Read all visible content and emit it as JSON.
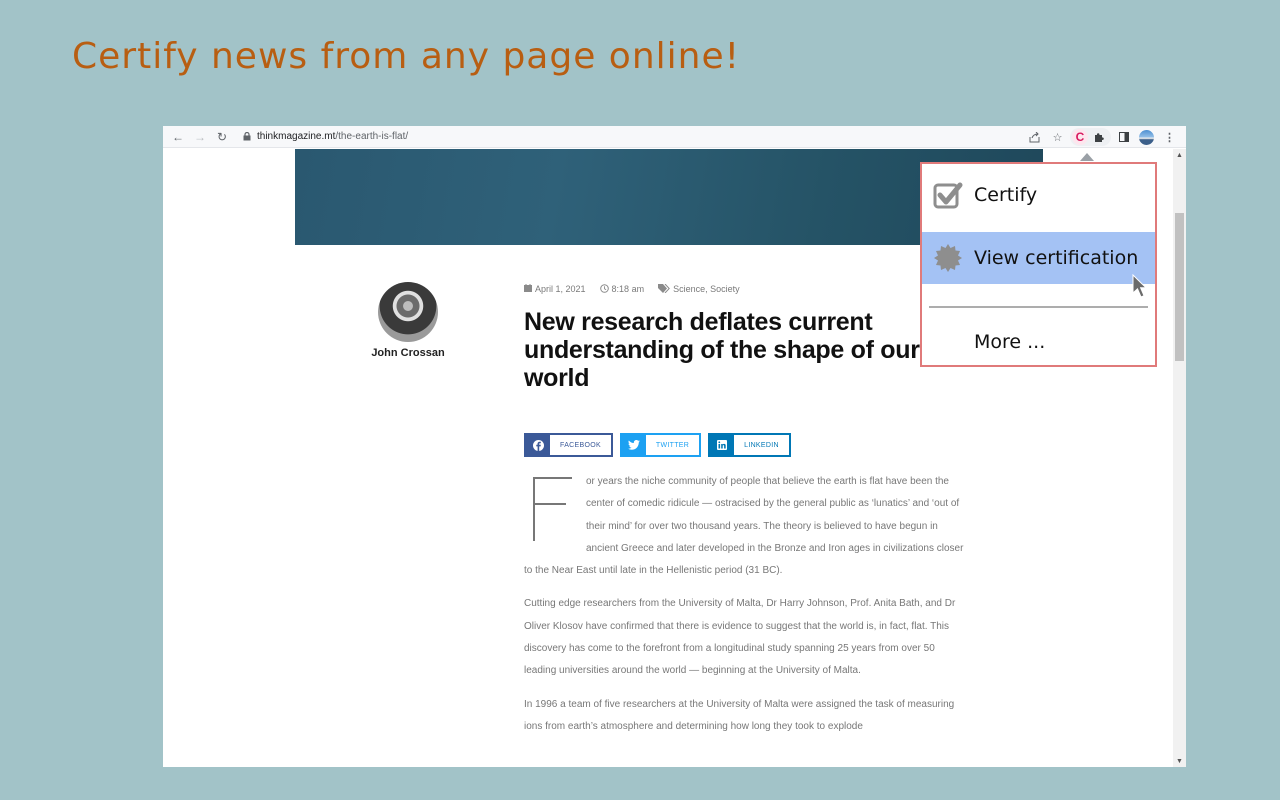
{
  "promo": {
    "title": "Certify news from any page online!"
  },
  "browser": {
    "url_host": "thinkmagazine.mt",
    "url_path": "/the-earth-is-flat/",
    "icons": {
      "back": "back-arrow-icon",
      "forward": "forward-arrow-icon",
      "reload": "reload-icon",
      "lock": "lock-icon",
      "share": "share-icon",
      "bookmark": "star-icon",
      "extension": "certify-extension-icon",
      "extensions_menu": "puzzle-icon",
      "side_panel": "side-panel-icon",
      "profile": "profile-avatar",
      "menu": "kebab-menu-icon"
    },
    "extension_letter": "C"
  },
  "article": {
    "author": "John Crossan",
    "date": "April 1, 2021",
    "time": "8:18 am",
    "categories": "Science, Society",
    "headline": "New research deflates current understanding of the shape of our world",
    "share_buttons": [
      {
        "label": "FACEBOOK",
        "icon": "f"
      },
      {
        "label": "TWITTER",
        "icon": "🐦"
      },
      {
        "label": "LINKEDIN",
        "icon": "in"
      }
    ],
    "dropcap": "F",
    "paragraphs": [
      "or years the niche community of people that believe the earth is flat have been the center of comedic ridicule — ostracised by the general public as ‘lunatics’ and ‘out of their mind’ for over two thousand years. The theory is believed to have begun in ancient Greece and later developed in the Bronze and Iron ages in civilizations closer to the Near East until late in the Hellenistic period (31 BC).",
      "Cutting edge researchers from the University of Malta, Dr Harry Johnson, Prof. Anita Bath, and Dr Oliver Klosov have confirmed that there is evidence to suggest that the world is, in fact, flat. This discovery has come to the forefront from a longitudinal study spanning 25 years from over 50 leading universities around the world — beginning at the University of Malta.",
      "In 1996 a team of five researchers at the University of Malta were assigned the task of measuring ions from earth’s atmosphere and determining how long they took to explode"
    ]
  },
  "popup": {
    "items": [
      {
        "label": "Certify",
        "icon": "checkbox-checked-icon"
      },
      {
        "label": "View certification",
        "icon": "seal-badge-icon",
        "highlighted": true
      },
      {
        "label": "More ..."
      }
    ],
    "colors": {
      "border": "#e07a7a",
      "highlight": "#a4c2f4"
    }
  },
  "colors": {
    "background": "#a2c3c8",
    "promo_title": "#b85e12",
    "extension_accent": "#d81b60"
  }
}
